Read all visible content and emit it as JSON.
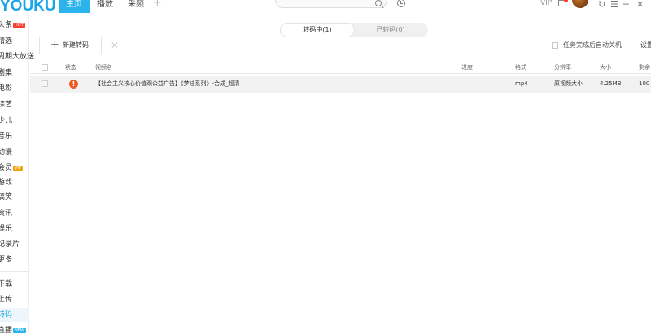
{
  "app": {
    "logo": "YOUKU",
    "nav_tabs": [
      "主页",
      "播放",
      "采频"
    ],
    "plus_label": "+",
    "vip_label": "VIP"
  },
  "sidebar": {
    "items": [
      {
        "label": "头条",
        "badge": "HOT",
        "badge_type": "hot"
      },
      {
        "label": "精选"
      },
      {
        "label": "周期大放送"
      },
      {
        "label": "剧集"
      },
      {
        "label": "电影"
      },
      {
        "label": "综艺"
      },
      {
        "label": "少儿"
      },
      {
        "label": "音乐"
      },
      {
        "label": "动漫"
      },
      {
        "label": "会员",
        "badge": "VIP",
        "badge_type": "vip"
      },
      {
        "label": "游戏"
      },
      {
        "label": "搞笑"
      },
      {
        "label": "资讯"
      },
      {
        "label": "娱乐"
      },
      {
        "label": "纪录片"
      },
      {
        "label": "更多"
      },
      {
        "label": "下载"
      },
      {
        "label": "上传"
      },
      {
        "label": "转码",
        "active": true
      },
      {
        "label": "直播",
        "badge": "NEW",
        "badge_type": "new"
      }
    ]
  },
  "transcode": {
    "tabs": [
      {
        "label": "转码中(1)",
        "active": true
      },
      {
        "label": "已转码(0)"
      }
    ],
    "new_button": "新建转码",
    "auto_shutdown": "任务完成后自动关机",
    "settings": "设置"
  },
  "table": {
    "columns": [
      "状态",
      "视频名",
      "进度",
      "格式",
      "分辨率",
      "大小",
      "剩余"
    ],
    "rows": [
      {
        "status": "!",
        "name": "【社会主义核心价值观公益广告】《梦娃系列》-合成_超清",
        "progress": "",
        "format": "mp4",
        "resolution": "原视频大小",
        "size": "4.25MB",
        "remaining": "100"
      }
    ]
  },
  "colors": {
    "accent": "#2bb3ee",
    "status_error": "#ee5a24",
    "row_bg": "#f2f2f2"
  }
}
